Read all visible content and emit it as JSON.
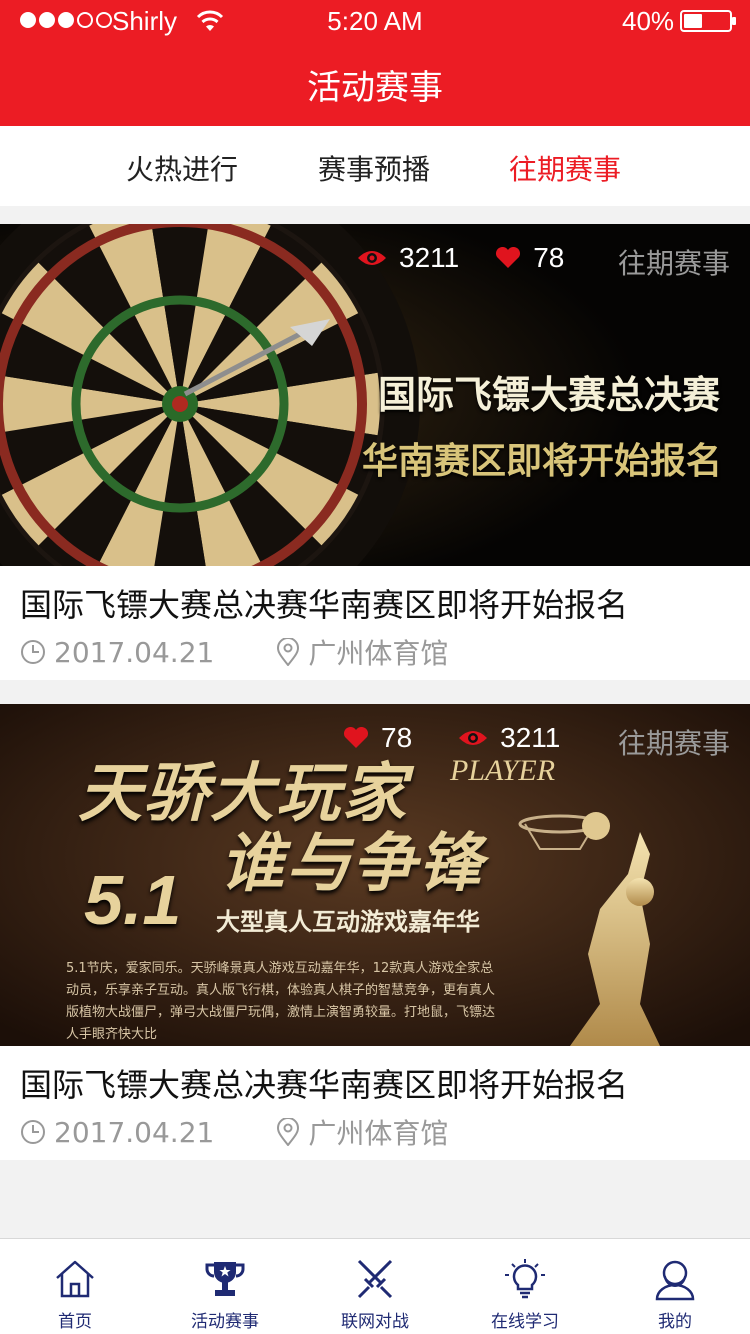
{
  "status_bar": {
    "carrier": "Shirly",
    "time": "5:20 AM",
    "battery_percent": "40%",
    "battery_level": 0.4,
    "signal_dots_filled": 3,
    "signal_dots_total": 5
  },
  "header": {
    "title": "活动赛事"
  },
  "tabs": [
    {
      "label": "火热进行",
      "active": false
    },
    {
      "label": "赛事预播",
      "active": false
    },
    {
      "label": "往期赛事",
      "active": true
    }
  ],
  "cards": [
    {
      "banner_tag": "往期赛事",
      "views": "3211",
      "likes": "78",
      "banner_line1": "国际飞镖大赛总决赛",
      "banner_line2": "华南赛区即将开始报名",
      "title": "国际飞镖大赛总决赛华南赛区即将开始报名",
      "date": "2017.04.21",
      "location": "广州体育馆"
    },
    {
      "banner_tag": "往期赛事",
      "views": "3211",
      "likes": "78",
      "banner_line1": "天骄大玩家",
      "banner_line2": "谁与争锋",
      "banner_player": "PLAYER",
      "banner_number": "5.1",
      "banner_subtitle": "大型真人互动游戏嘉年华",
      "banner_body": "5.1节庆，爱家同乐。天骄峰景真人游戏互动嘉年华，12款真人游戏全家总动员，乐享亲子互动。真人版飞行棋，体验真人棋子的智慧竞争，更有真人版植物大战僵尸，弹弓大战僵尸玩偶，激情上演智勇较量。打地鼠，飞镖达人手眼齐快大比",
      "title": "国际飞镖大赛总决赛华南赛区即将开始报名",
      "date": "2017.04.21",
      "location": "广州体育馆"
    }
  ],
  "bottom_nav": [
    {
      "label": "首页",
      "icon": "home-icon"
    },
    {
      "label": "活动赛事",
      "icon": "trophy-icon"
    },
    {
      "label": "联网对战",
      "icon": "crossed-swords-icon"
    },
    {
      "label": "在线学习",
      "icon": "lightbulb-icon"
    },
    {
      "label": "我的",
      "icon": "user-icon"
    }
  ],
  "colors": {
    "brand_red": "#ec1c24",
    "nav_blue": "#1f2a73",
    "meta_gray": "#999999"
  }
}
